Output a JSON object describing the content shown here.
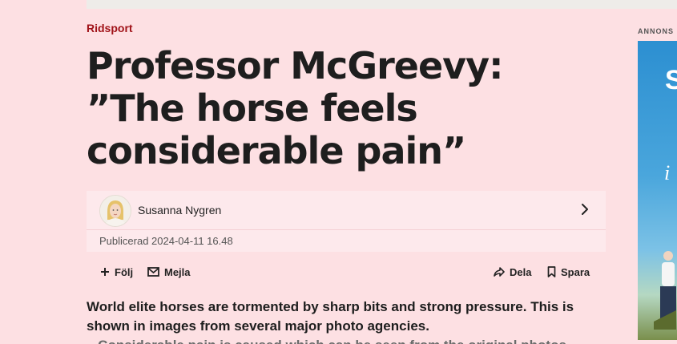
{
  "article": {
    "category": "Ridsport",
    "headline_lines": [
      "Professor McGreevy:",
      "”The horse feels",
      "considerable pain”"
    ],
    "author": {
      "name": "Susanna Nygren",
      "avatar_icon": "author-photo"
    },
    "published": "Publicerad 2024-04-11 16.48",
    "actions": {
      "follow": "Följ",
      "email": "Mejla",
      "share": "Dela",
      "save": "Spara"
    },
    "lead_lines": [
      "World elite horses are tormented by sharp bits and strong pressure. This is",
      "shown in images from several major photo agencies."
    ],
    "lead_cutoff": "– Considerable pain is caused which can be seen from the original photos"
  },
  "ad": {
    "label": "ANNONS",
    "letter_top": "S",
    "letter_mid": "i"
  },
  "colors": {
    "page_bg": "#fde0e3",
    "category": "#a01218",
    "byline_bg": "#fde9ec",
    "topbar": "#eeece9"
  }
}
